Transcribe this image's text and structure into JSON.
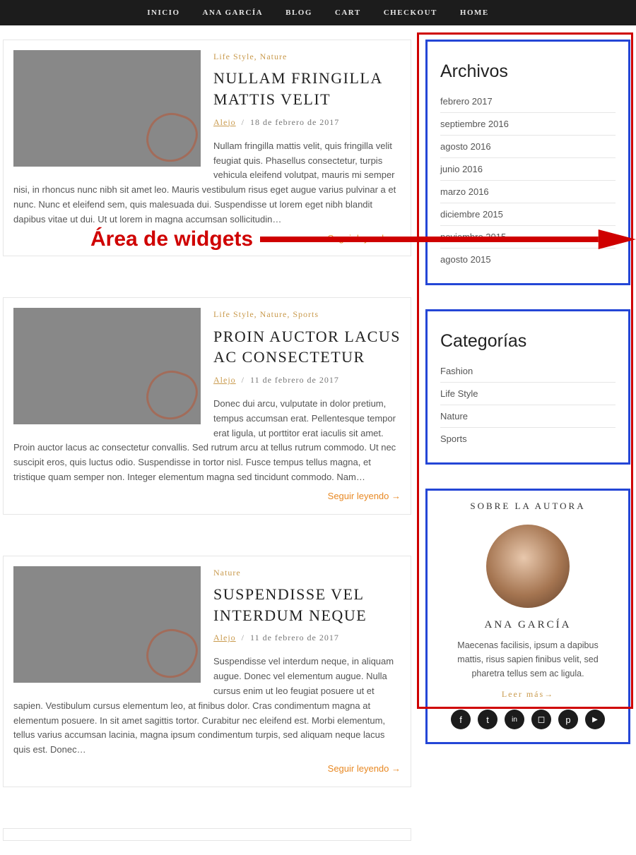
{
  "nav": {
    "items": [
      "INICIO",
      "ANA GARCÍA",
      "BLOG",
      "CART",
      "CHECKOUT",
      "HOME"
    ]
  },
  "annotation": {
    "label": "Área de widgets"
  },
  "posts": [
    {
      "categories": [
        "Life Style",
        "Nature"
      ],
      "title": "NULLAM FRINGILLA MATTIS VELIT",
      "author": "Alejo",
      "date": "18 de febrero de 2017",
      "excerpt": "Nullam fringilla mattis velit, quis fringilla velit feugiat quis. Phasellus consectetur, turpis vehicula eleifend volutpat, mauris mi semper nisi, in rhoncus nunc nibh sit amet leo. Mauris vestibulum risus eget augue varius pulvinar a et nunc. Nunc et eleifend sem, quis malesuada dui. Suspendisse ut lorem eget nibh blandit dapibus vitae ut dui. Ut ut lorem in magna accumsan sollicitudin…",
      "readmore": "Seguir leyendo →"
    },
    {
      "categories": [
        "Life Style",
        "Nature",
        "Sports"
      ],
      "title": "PROIN AUCTOR LACUS AC CONSECTETUR",
      "author": "Alejo",
      "date": "11 de febrero de 2017",
      "excerpt": "Donec dui arcu, vulputate in dolor pretium, tempus accumsan erat. Pellentesque tempor erat ligula, ut porttitor erat iaculis sit amet. Proin auctor lacus ac consectetur convallis. Sed rutrum arcu at tellus rutrum commodo. Ut nec suscipit eros, quis luctus odio. Suspendisse in tortor nisl. Fusce tempus tellus magna, et tristique quam semper non. Integer elementum magna sed tincidunt commodo. Nam…",
      "readmore": "Seguir leyendo →"
    },
    {
      "categories": [
        "Nature"
      ],
      "title": "SUSPENDISSE VEL INTERDUM NEQUE",
      "author": "Alejo",
      "date": "11 de febrero de 2017",
      "excerpt": "Suspendisse vel interdum neque, in aliquam augue. Donec vel elementum augue. Nulla cursus enim ut leo feugiat posuere ut et sapien. Vestibulum cursus elementum leo, at finibus dolor. Cras condimentum magna at elementum posuere. In sit amet sagittis tortor. Curabitur nec eleifend est. Morbi elementum, tellus varius accumsan lacinia, magna ipsum condimentum turpis, sed aliquam neque lacus quis est. Donec…",
      "readmore": "Seguir leyendo →"
    }
  ],
  "sidebar": {
    "archives": {
      "title": "Archivos",
      "items": [
        "febrero 2017",
        "septiembre 2016",
        "agosto 2016",
        "junio 2016",
        "marzo 2016",
        "diciembre 2015",
        "noviembre 2015",
        "agosto 2015"
      ]
    },
    "categories": {
      "title": "Categorías",
      "items": [
        "Fashion",
        "Life Style",
        "Nature",
        "Sports"
      ]
    },
    "author": {
      "heading": "SOBRE LA AUTORA",
      "name": "ANA GARCÍA",
      "bio": "Maecenas facilisis, ipsum a dapibus mattis, risus sapien finibus velit, sed pharetra tellus sem ac ligula.",
      "more": "Leer más→",
      "socials": [
        "facebook",
        "twitter",
        "linkedin",
        "instagram",
        "pinterest",
        "youtube"
      ],
      "social_glyphs": {
        "facebook": "f",
        "twitter": "t",
        "linkedin": "in",
        "instagram": "◻",
        "pinterest": "p",
        "youtube": "▶"
      }
    }
  }
}
